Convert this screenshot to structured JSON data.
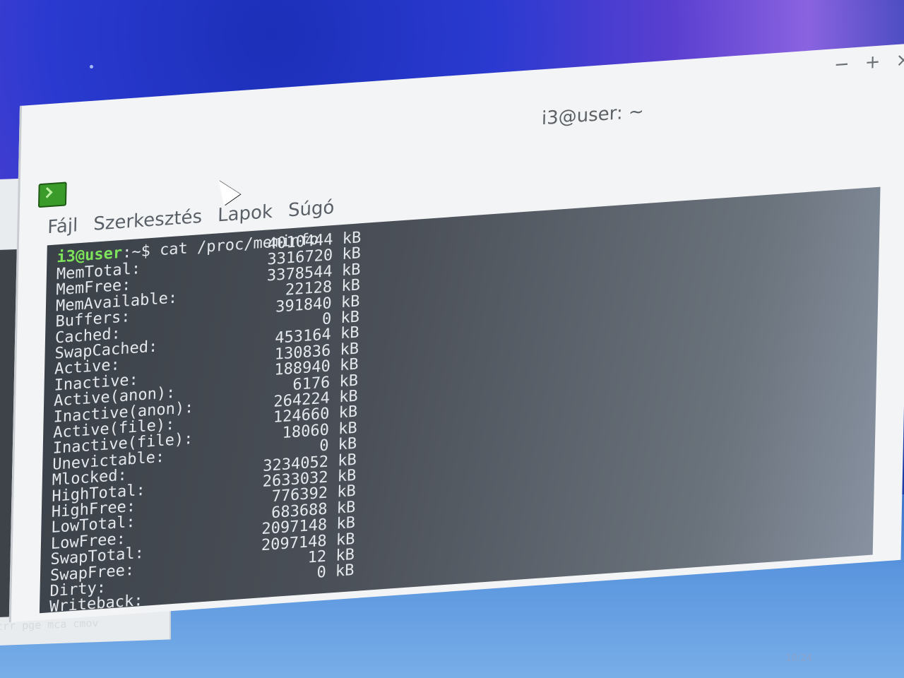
{
  "window": {
    "title": "i3@user: ~",
    "controls": [
      "−",
      "+",
      "×"
    ]
  },
  "menu": [
    "Fájl",
    "Szerkesztés",
    "Lapok",
    "Súgó"
  ],
  "prompt": {
    "user": "i3@user",
    "rest": ":~$ cat /proc/meminfo"
  },
  "meminfo": [
    {
      "key": "MemTotal:",
      "value": "4010444 kB"
    },
    {
      "key": "MemFree:",
      "value": "3316720 kB"
    },
    {
      "key": "MemAvailable:",
      "value": "3378544 kB"
    },
    {
      "key": "Buffers:",
      "value": "22128 kB"
    },
    {
      "key": "Cached:",
      "value": "391840 kB"
    },
    {
      "key": "SwapCached:",
      "value": "0 kB"
    },
    {
      "key": "Active:",
      "value": "453164 kB"
    },
    {
      "key": "Inactive:",
      "value": "130836 kB"
    },
    {
      "key": "Active(anon):",
      "value": "188940 kB"
    },
    {
      "key": "Inactive(anon):",
      "value": "6176 kB"
    },
    {
      "key": "Active(file):",
      "value": "264224 kB"
    },
    {
      "key": "Inactive(file):",
      "value": "124660 kB"
    },
    {
      "key": "Unevictable:",
      "value": "18060 kB"
    },
    {
      "key": "Mlocked:",
      "value": "0 kB"
    },
    {
      "key": "HighTotal:",
      "value": "3234052 kB"
    },
    {
      "key": "HighFree:",
      "value": "2633032 kB"
    },
    {
      "key": "LowTotal:",
      "value": "776392 kB"
    },
    {
      "key": "LowFree:",
      "value": "683688 kB"
    },
    {
      "key": "SwapTotal:",
      "value": "2097148 kB"
    },
    {
      "key": "SwapFree:",
      "value": "2097148 kB"
    },
    {
      "key": "Dirty:",
      "value": "12 kB"
    },
    {
      "key": "Writeback:",
      "value": "0 kB"
    }
  ],
  "left_terminal": {
    "flags_line": "mtrr pge mca cmov"
  },
  "taskbar": {
    "clock": "10:24"
  }
}
